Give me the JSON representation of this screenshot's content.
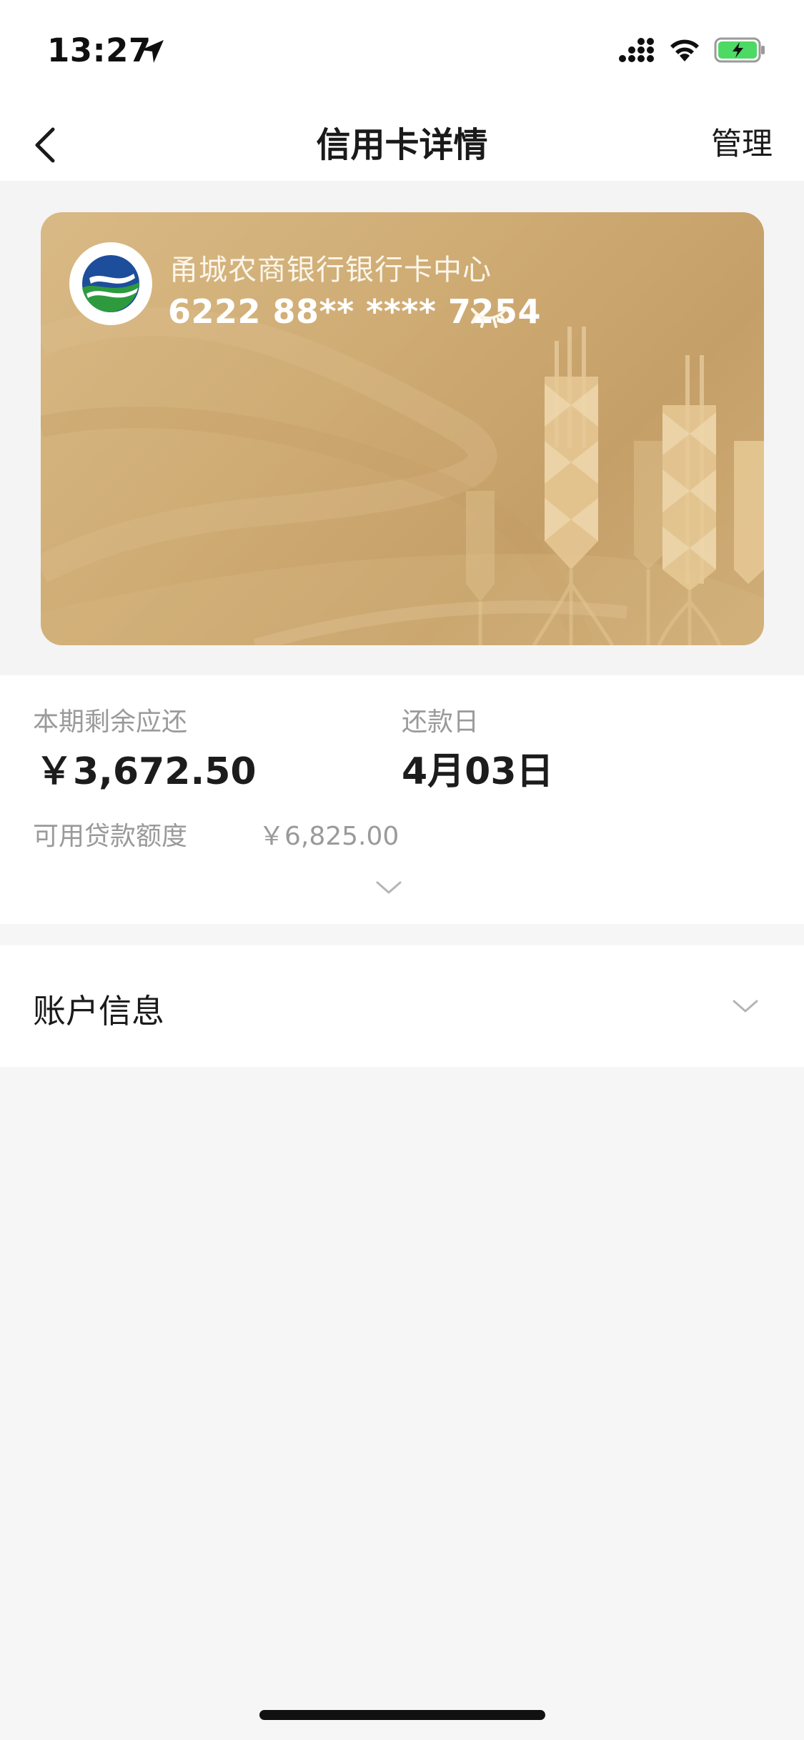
{
  "status_bar": {
    "time": "13:27"
  },
  "nav": {
    "title": "信用卡详情",
    "manage_label": "管理"
  },
  "card": {
    "bank_name": "甬城农商银行银行卡中心",
    "card_number": "6222 88** **** 7254"
  },
  "summary": {
    "balance_label": "本期剩余应还",
    "balance_value": "￥3,672.50",
    "due_label": "还款日",
    "due_value": "4月03日",
    "credit_label": "可用贷款额度",
    "credit_value": "￥6,825.00"
  },
  "account_info": {
    "title": "账户信息"
  },
  "colors": {
    "card_gold": "#cfac74",
    "page_bg": "#f6f6f6",
    "logo_green": "#2e9a3e",
    "logo_blue": "#1d4e9c"
  }
}
